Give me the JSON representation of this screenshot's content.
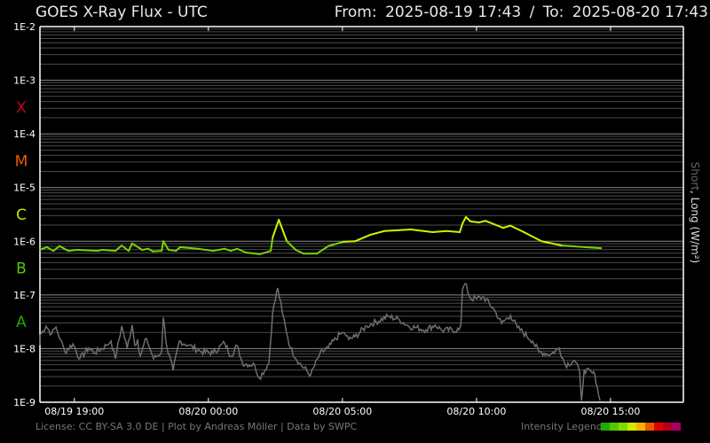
{
  "header": {
    "title": "GOES X-Ray Flux - UTC",
    "from_label": "From:",
    "from_value": "2025-08-19 17:43",
    "separator": "/",
    "to_label": "To:",
    "to_value": "2025-08-20 17:43"
  },
  "footer": {
    "credits": "License: CC BY-SA 3.0 DE | Plot by Andreas Möller | Data by SWPC",
    "legend_label": "Intensity Legend",
    "legend_colors": [
      "#22aa00",
      "#55c800",
      "#80dc00",
      "#d4e800",
      "#f0b400",
      "#e85a00",
      "#e40000",
      "#b40020",
      "#a80060"
    ]
  },
  "chart_data": {
    "type": "line",
    "title": "GOES X-Ray Flux - UTC",
    "ylabel_short": "Short",
    "ylabel_sep": ",",
    "ylabel_long": "Long (W/m²)",
    "yscale": "log",
    "ylim": [
      1e-09,
      0.01
    ],
    "y_ticks": [
      "1E-2",
      "1E-3",
      "1E-4",
      "1E-5",
      "1E-6",
      "1E-7",
      "1E-8",
      "1E-9"
    ],
    "flare_classes": [
      {
        "label": "X",
        "color": "#c80020"
      },
      {
        "label": "M",
        "color": "#e85a00"
      },
      {
        "label": "C",
        "color": "#c8e000"
      },
      {
        "label": "B",
        "color": "#5ec800"
      },
      {
        "label": "A",
        "color": "#22a800"
      }
    ],
    "x_unit": "hours since 2025-08-19 17:43 UTC",
    "xlim": [
      0,
      24
    ],
    "x_ticks": [
      {
        "label": "08/19 19:00",
        "hours": 1.283
      },
      {
        "label": "08/20 00:00",
        "hours": 6.283
      },
      {
        "label": "08/20 05:00",
        "hours": 11.283
      },
      {
        "label": "08/20 10:00",
        "hours": 16.283
      },
      {
        "label": "08/20 15:00",
        "hours": 21.283
      }
    ],
    "grid": true,
    "series": [
      {
        "name": "Long",
        "value_unit": "log10 W/m²",
        "color_low": "#77d400",
        "color_high": "#d4f000",
        "points": [
          [
            0,
            -6.16
          ],
          [
            0.26,
            -6.11
          ],
          [
            0.5,
            -6.18
          ],
          [
            0.73,
            -6.09
          ],
          [
            1.06,
            -6.18
          ],
          [
            1.39,
            -6.16
          ],
          [
            2.15,
            -6.18
          ],
          [
            2.32,
            -6.16
          ],
          [
            2.81,
            -6.18
          ],
          [
            3.05,
            -6.08
          ],
          [
            3.31,
            -6.18
          ],
          [
            3.44,
            -6.04
          ],
          [
            3.81,
            -6.16
          ],
          [
            4.04,
            -6.14
          ],
          [
            4.21,
            -6.19
          ],
          [
            4.54,
            -6.18
          ],
          [
            4.6,
            -6.0
          ],
          [
            4.8,
            -6.16
          ],
          [
            5.07,
            -6.18
          ],
          [
            5.23,
            -6.11
          ],
          [
            5.89,
            -6.14
          ],
          [
            6.46,
            -6.18
          ],
          [
            6.89,
            -6.14
          ],
          [
            7.12,
            -6.18
          ],
          [
            7.35,
            -6.14
          ],
          [
            7.68,
            -6.21
          ],
          [
            8.21,
            -6.24
          ],
          [
            8.61,
            -6.18
          ],
          [
            8.68,
            -5.93
          ],
          [
            8.91,
            -5.6
          ],
          [
            9.21,
            -6.0
          ],
          [
            9.54,
            -6.16
          ],
          [
            9.83,
            -6.23
          ],
          [
            10.33,
            -6.23
          ],
          [
            10.76,
            -6.09
          ],
          [
            11.32,
            -6.01
          ],
          [
            11.75,
            -6.0
          ],
          [
            12.32,
            -5.88
          ],
          [
            12.85,
            -5.81
          ],
          [
            13.84,
            -5.78
          ],
          [
            14.64,
            -5.83
          ],
          [
            15.17,
            -5.81
          ],
          [
            15.66,
            -5.83
          ],
          [
            15.76,
            -5.67
          ],
          [
            15.89,
            -5.55
          ],
          [
            16.06,
            -5.63
          ],
          [
            16.39,
            -5.65
          ],
          [
            16.62,
            -5.62
          ],
          [
            17.28,
            -5.75
          ],
          [
            17.55,
            -5.71
          ],
          [
            18.05,
            -5.83
          ],
          [
            18.71,
            -6.0
          ],
          [
            19.47,
            -6.08
          ],
          [
            20.36,
            -6.11
          ],
          [
            20.93,
            -6.13
          ]
        ]
      },
      {
        "name": "Short",
        "value_unit": "log10 W/m²",
        "color": "#6e6e6e",
        "points": [
          [
            0,
            -7.94
          ],
          [
            0,
            -7.75
          ],
          [
            0.23,
            -7.58
          ],
          [
            0.43,
            -7.73
          ],
          [
            0.6,
            -7.6
          ],
          [
            0.76,
            -7.83
          ],
          [
            0.93,
            -8.06
          ],
          [
            1.23,
            -7.91
          ],
          [
            1.49,
            -8.19
          ],
          [
            1.82,
            -7.99
          ],
          [
            2.05,
            -8.08
          ],
          [
            2.48,
            -7.94
          ],
          [
            2.65,
            -7.86
          ],
          [
            2.81,
            -8.19
          ],
          [
            3.05,
            -7.58
          ],
          [
            3.25,
            -7.99
          ],
          [
            3.44,
            -7.56
          ],
          [
            3.54,
            -7.94
          ],
          [
            3.64,
            -7.83
          ],
          [
            3.74,
            -8.14
          ],
          [
            3.97,
            -7.81
          ],
          [
            4.24,
            -8.19
          ],
          [
            4.54,
            -8.06
          ],
          [
            4.6,
            -7.42
          ],
          [
            4.74,
            -7.99
          ],
          [
            4.97,
            -8.41
          ],
          [
            5.2,
            -7.86
          ],
          [
            5.56,
            -7.94
          ],
          [
            6.03,
            -8.06
          ],
          [
            6.46,
            -8.08
          ],
          [
            6.89,
            -7.89
          ],
          [
            7.12,
            -8.14
          ],
          [
            7.35,
            -7.94
          ],
          [
            7.55,
            -8.27
          ],
          [
            8.01,
            -8.31
          ],
          [
            8.18,
            -8.55
          ],
          [
            8.54,
            -8.27
          ],
          [
            8.68,
            -7.33
          ],
          [
            8.87,
            -6.87
          ],
          [
            9.04,
            -7.33
          ],
          [
            9.34,
            -7.99
          ],
          [
            9.67,
            -8.27
          ],
          [
            10.1,
            -8.49
          ],
          [
            10.43,
            -8.11
          ],
          [
            10.76,
            -7.98
          ],
          [
            11.19,
            -7.73
          ],
          [
            11.36,
            -7.71
          ],
          [
            11.52,
            -7.83
          ],
          [
            11.75,
            -7.78
          ],
          [
            12.19,
            -7.58
          ],
          [
            12.98,
            -7.4
          ],
          [
            13.41,
            -7.46
          ],
          [
            13.74,
            -7.58
          ],
          [
            14.4,
            -7.65
          ],
          [
            14.74,
            -7.56
          ],
          [
            15.0,
            -7.66
          ],
          [
            15.63,
            -7.65
          ],
          [
            15.7,
            -7.56
          ],
          [
            15.76,
            -6.9
          ],
          [
            15.86,
            -6.79
          ],
          [
            16.06,
            -7.07
          ],
          [
            16.29,
            -7.07
          ],
          [
            16.56,
            -7.04
          ],
          [
            16.95,
            -7.28
          ],
          [
            17.22,
            -7.53
          ],
          [
            17.55,
            -7.38
          ],
          [
            17.81,
            -7.61
          ],
          [
            18.38,
            -7.86
          ],
          [
            18.61,
            -8.06
          ],
          [
            19.04,
            -8.11
          ],
          [
            19.37,
            -7.99
          ],
          [
            19.6,
            -8.31
          ],
          [
            19.93,
            -8.22
          ],
          [
            20.13,
            -8.44
          ],
          [
            20.2,
            -8.97
          ],
          [
            20.3,
            -8.39
          ],
          [
            20.7,
            -8.49
          ],
          [
            20.79,
            -8.72
          ],
          [
            20.89,
            -8.97
          ]
        ]
      }
    ]
  }
}
